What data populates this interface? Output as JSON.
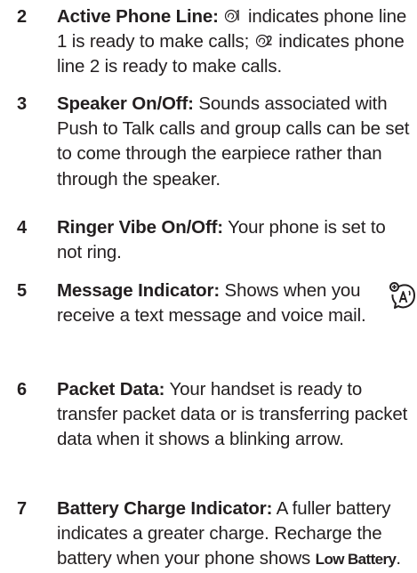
{
  "items": [
    {
      "number": "2",
      "term": "Active Phone Line:",
      "text_a": "indicates phone line 1 is ready to make calls;",
      "text_b": "indicates phone line 2 is ready to make calls.",
      "icons": [
        "line-1-icon",
        "line-2-icon"
      ]
    },
    {
      "number": "3",
      "term": "Speaker On/Off:",
      "text": "Sounds associated with Push to Talk calls and group calls can be set to come through the earpiece rather than through the speaker."
    },
    {
      "number": "4",
      "term": "Ringer Vibe On/Off:",
      "text": "Your phone is set to not ring."
    },
    {
      "number": "5",
      "term": "Message Indicator:",
      "text": "Shows when you receive a text message and voice mail.",
      "icon": "message-indicator-icon"
    },
    {
      "number": "6",
      "term": "Packet Data:",
      "text": "Your handset is ready to transfer packet data or is transferring packet data when it shows a blinking arrow."
    },
    {
      "number": "7",
      "term": "Battery Charge Indicator:",
      "text": "A fuller battery indicates a greater charge. Recharge the battery when your phone shows",
      "display_text": "Low Battery",
      "end": "."
    }
  ]
}
